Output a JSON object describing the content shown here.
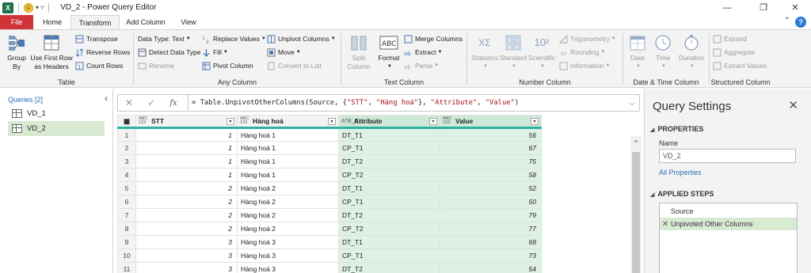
{
  "window": {
    "title": "VD_2 - Power Query Editor",
    "logo_letter": "X",
    "qat_dropdown": "▾ ▿"
  },
  "tabs": [
    "File",
    "Home",
    "Transform",
    "Add Column",
    "View"
  ],
  "ribbon": {
    "table": {
      "group_label": "Table",
      "group_by": "Group\nBy",
      "use_first_row": "Use First Row\nas Headers",
      "transpose": "Transpose",
      "reverse_rows": "Reverse Rows",
      "count_rows": "Count Rows"
    },
    "any_column": {
      "group_label": "Any Column",
      "data_type": "Data Type: Text",
      "detect_data_type": "Detect Data Type",
      "rename": "Rename",
      "replace_values": "Replace Values",
      "fill": "Fill",
      "pivot_column": "Pivot Column",
      "unpivot_columns": "Unpivot Columns",
      "move": "Move",
      "convert_to_list": "Convert to List"
    },
    "text_column": {
      "group_label": "Text Column",
      "split_column": "Split\nColumn",
      "format": "Format",
      "format_icon_text": "ABC",
      "merge_columns": "Merge Columns",
      "extract": "Extract",
      "parse": "Parse"
    },
    "number_column": {
      "group_label": "Number Column",
      "statistics": "Statistics",
      "standard": "Standard",
      "scientific": "Scientific",
      "scientific_icon": "10²",
      "statistics_icon": "XΣ",
      "trigonometry": "Trigonometry",
      "rounding": "Rounding",
      "information": "Information"
    },
    "datetime_column": {
      "group_label": "Date & Time Column",
      "date": "Date",
      "time": "Time",
      "duration": "Duration"
    },
    "structured_column": {
      "group_label": "Structured Column",
      "expand": "Expand",
      "aggregate": "Aggregate",
      "extract_values": "Extract Values"
    }
  },
  "queries": {
    "header": "Queries [2]",
    "items": [
      "VD_1",
      "VD_2"
    ],
    "selected": "VD_2"
  },
  "formula_bar": {
    "cancel": "✕",
    "commit": "✓",
    "fx": "fx",
    "prefix": "= Table.UnpivotOtherColumns(Source, {",
    "str1": "\"STT\"",
    "sep1": ", ",
    "str2": "\"Hàng hoá\"",
    "mid": "}, ",
    "str3": "\"Attribute\"",
    "sep2": ", ",
    "str4": "\"Value\"",
    "suffix": ")",
    "expand": "⌵"
  },
  "grid": {
    "corner_icon": "▦",
    "columns": [
      {
        "name": "STT",
        "type": "ABC\n123"
      },
      {
        "name": "Hàng hoá",
        "type": "ABC\n123"
      },
      {
        "name": "Attribute",
        "type": "A^B_C"
      },
      {
        "name": "Value",
        "type": "ABC\n123"
      }
    ],
    "rows": [
      [
        "1",
        "1",
        "Hàng hoá 1",
        "DT_T1",
        "56"
      ],
      [
        "2",
        "1",
        "Hàng hoá 1",
        "CP_T1",
        "67"
      ],
      [
        "3",
        "1",
        "Hàng hoá 1",
        "DT_T2",
        "75"
      ],
      [
        "4",
        "1",
        "Hàng hoá 1",
        "CP_T2",
        "58"
      ],
      [
        "5",
        "2",
        "Hàng hoá 2",
        "DT_T1",
        "52"
      ],
      [
        "6",
        "2",
        "Hàng hoá 2",
        "CP_T1",
        "50"
      ],
      [
        "7",
        "2",
        "Hàng hoá 2",
        "DT_T2",
        "79"
      ],
      [
        "8",
        "2",
        "Hàng hoá 2",
        "CP_T2",
        "77"
      ],
      [
        "9",
        "3",
        "Hàng hoá 3",
        "DT_T1",
        "68"
      ],
      [
        "10",
        "3",
        "Hàng hoá 3",
        "CP_T1",
        "73"
      ],
      [
        "11",
        "3",
        "Hàng hoá 3",
        "DT_T2",
        "54"
      ]
    ]
  },
  "query_settings": {
    "title": "Query Settings",
    "properties_label": "PROPERTIES",
    "name_label": "Name",
    "name_value": "VD_2",
    "all_properties": "All Properties",
    "applied_steps_label": "APPLIED STEPS",
    "steps": [
      "Source",
      "Unpivoted Other Columns"
    ],
    "selected_step": "Unpivoted Other Columns"
  },
  "colors": {
    "file_tab": "#d13438",
    "selected_bg": "#d9ead3",
    "highlight_column": "#dff0e6",
    "link": "#2b6fb6",
    "teal_bar": "#2bb3a0"
  }
}
